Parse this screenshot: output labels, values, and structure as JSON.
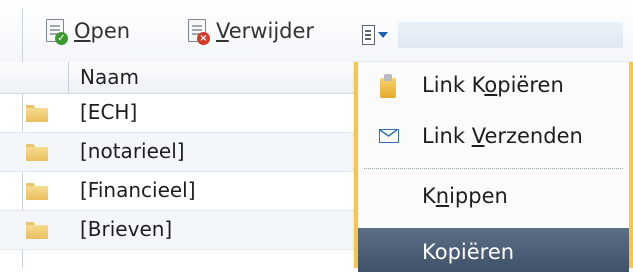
{
  "toolbar": {
    "open_label_prefix": "",
    "open_label_key": "O",
    "open_label_rest": "pen",
    "delete_label_key": "V",
    "delete_label_rest": "erwijder"
  },
  "file_list": {
    "column_header": "Naam",
    "rows": [
      {
        "name": "[ECH]"
      },
      {
        "name": "[notarieel]"
      },
      {
        "name": "[Financieel]"
      },
      {
        "name": "[Brieven]"
      }
    ]
  },
  "context_menu": {
    "items": [
      {
        "pre": "Link K",
        "key": "o",
        "post": "piëren",
        "icon": "clipboard-icon"
      },
      {
        "pre": "Link ",
        "key": "V",
        "post": "erzenden",
        "icon": "envelope-icon"
      },
      {
        "pre": "K",
        "key": "n",
        "post": "ippen",
        "icon": ""
      },
      {
        "pre": "Kopiëren",
        "key": "",
        "post": "",
        "icon": ""
      }
    ]
  },
  "colors": {
    "menu_border": "#f6c64a",
    "menu_highlight": "#4a5d76",
    "folder": "#f0c96a"
  }
}
